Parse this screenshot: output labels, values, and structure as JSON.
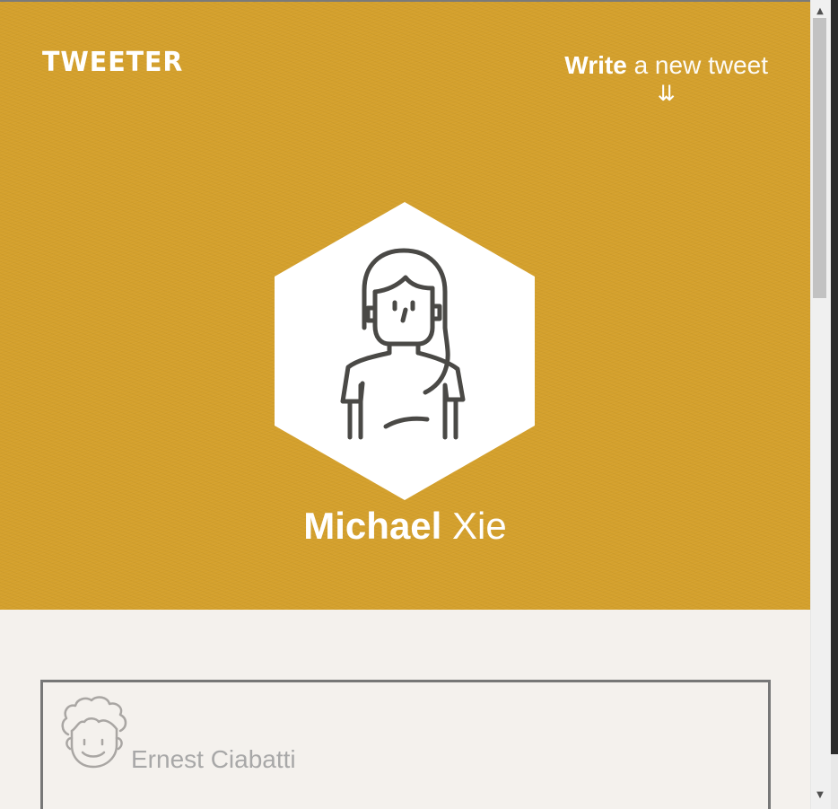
{
  "header": {
    "brand": "TWEETER",
    "compose_bold": "Write",
    "compose_rest": "a new tweet",
    "compose_arrow": "⇊"
  },
  "profile": {
    "first_name": "Michael",
    "last_name": "Xie",
    "avatar_icon": "woman-avatar-icon"
  },
  "tweets": [
    {
      "author": "Ernest Ciabatti",
      "avatar_icon": "curly-hair-man-avatar-icon"
    }
  ],
  "colors": {
    "hero_background": "#d4a02c",
    "page_background": "#f4f1ed",
    "card_border": "#777777",
    "author_text": "#a8a8a8"
  }
}
